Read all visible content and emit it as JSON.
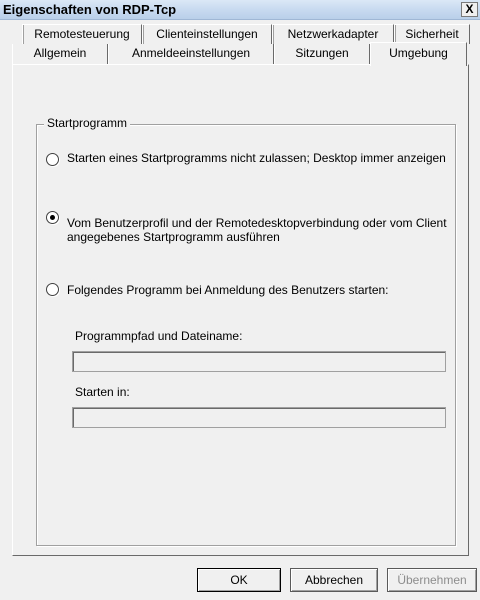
{
  "window": {
    "title": "Eigenschaften von RDP-Tcp",
    "close_symbol": "X"
  },
  "tabs": {
    "row1": [
      "Remotesteuerung",
      "Clienteinstellungen",
      "Netzwerkadapter",
      "Sicherheit"
    ],
    "row2": [
      "Allgemein",
      "Anmeldeeinstellungen",
      "Sitzungen",
      "Umgebung"
    ],
    "active": "Umgebung"
  },
  "startprogramm": {
    "group_label": "Startprogramm",
    "options": [
      {
        "label": "Starten eines Startprogramms nicht zulassen; Desktop immer anzeigen",
        "checked": false
      },
      {
        "label": "Vom Benutzerprofil und der Remotedesktopverbindung oder vom Client angegebenes Startprogramm ausführen",
        "checked": true
      },
      {
        "label": "Folgendes Programm bei Anmeldung des Benutzers starten:",
        "checked": false
      }
    ],
    "program_path_label": "Programmpfad und Dateiname:",
    "program_path_value": "",
    "start_in_label": "Starten in:",
    "start_in_value": ""
  },
  "buttons": {
    "ok": "OK",
    "cancel": "Abbrechen",
    "apply": "Übernehmen"
  }
}
